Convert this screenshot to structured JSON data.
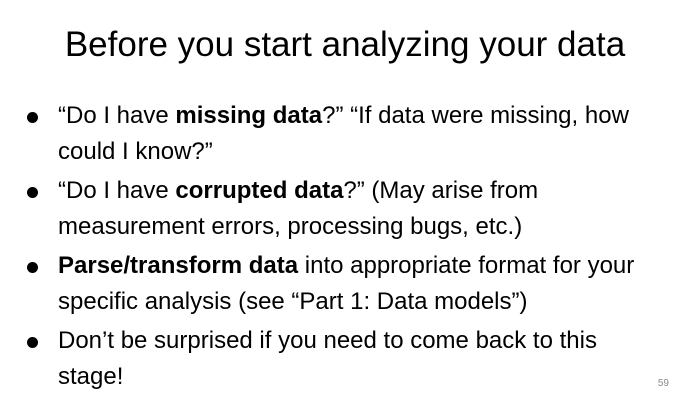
{
  "slide": {
    "title": "Before you start analyzing your data",
    "page_number": "59"
  },
  "bullets": [
    {
      "pre": "“Do I have ",
      "bold": "missing data",
      "post": "?” “If data were missing, how could I know?”"
    },
    {
      "pre": "“Do I have ",
      "bold": "corrupted data",
      "post": "?” (May arise from measurement errors, processing bugs, etc.)"
    },
    {
      "pre": "",
      "bold": "Parse/transform data",
      "post": " into appropriate format for your specific analysis (see “Part 1: Data models”)"
    },
    {
      "pre": "Don’t be surprised if you need to come back to this stage!",
      "bold": "",
      "post": ""
    }
  ]
}
